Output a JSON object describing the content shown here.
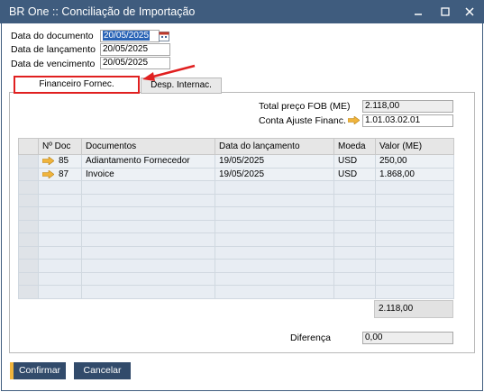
{
  "window": {
    "title": "BR One :: Conciliação de Importação"
  },
  "header": {
    "doc_date_label": "Data do documento",
    "doc_date_value": "20/05/2025",
    "posting_date_label": "Data de lançamento",
    "posting_date_value": "20/05/2025",
    "due_date_label": "Data de vencimento",
    "due_date_value": "20/05/2025"
  },
  "tabs": [
    {
      "label": "Financeiro Fornec.",
      "active": true
    },
    {
      "label": "Desp. Internac.",
      "active": false
    }
  ],
  "summary": {
    "fob_total_label": "Total preço FOB (ME)",
    "fob_total_value": "2.118,00",
    "adjust_account_label": "Conta Ajuste Financ.",
    "adjust_account_value": "1.01.03.02.01"
  },
  "table": {
    "columns": [
      "Nº Doc",
      "Documentos",
      "Data do lançamento",
      "Moeda",
      "Valor (ME)"
    ],
    "rows": [
      {
        "doc": "85",
        "document": "Adiantamento Fornecedor",
        "date": "19/05/2025",
        "currency": "USD",
        "value": "250,00"
      },
      {
        "doc": "87",
        "document": "Invoice",
        "date": "19/05/2025",
        "currency": "USD",
        "value": "1.868,00"
      }
    ],
    "total": "2.118,00"
  },
  "footer": {
    "difference_label": "Diferença",
    "difference_value": "0,00",
    "confirm_label": "Confirmar",
    "cancel_label": "Cancelar"
  },
  "colors": {
    "titlebar": "#3f5c7e",
    "button": "#324b6b",
    "button_accent": "#f0b43c",
    "highlight_annotation": "#e02020",
    "link_arrow": "#f0b43c"
  },
  "icons": {
    "link_arrow": "orange-link-arrow-icon",
    "calendar": "calendar-icon",
    "minimize": "minimize-icon",
    "maximize": "maximize-icon",
    "close": "close-icon"
  }
}
